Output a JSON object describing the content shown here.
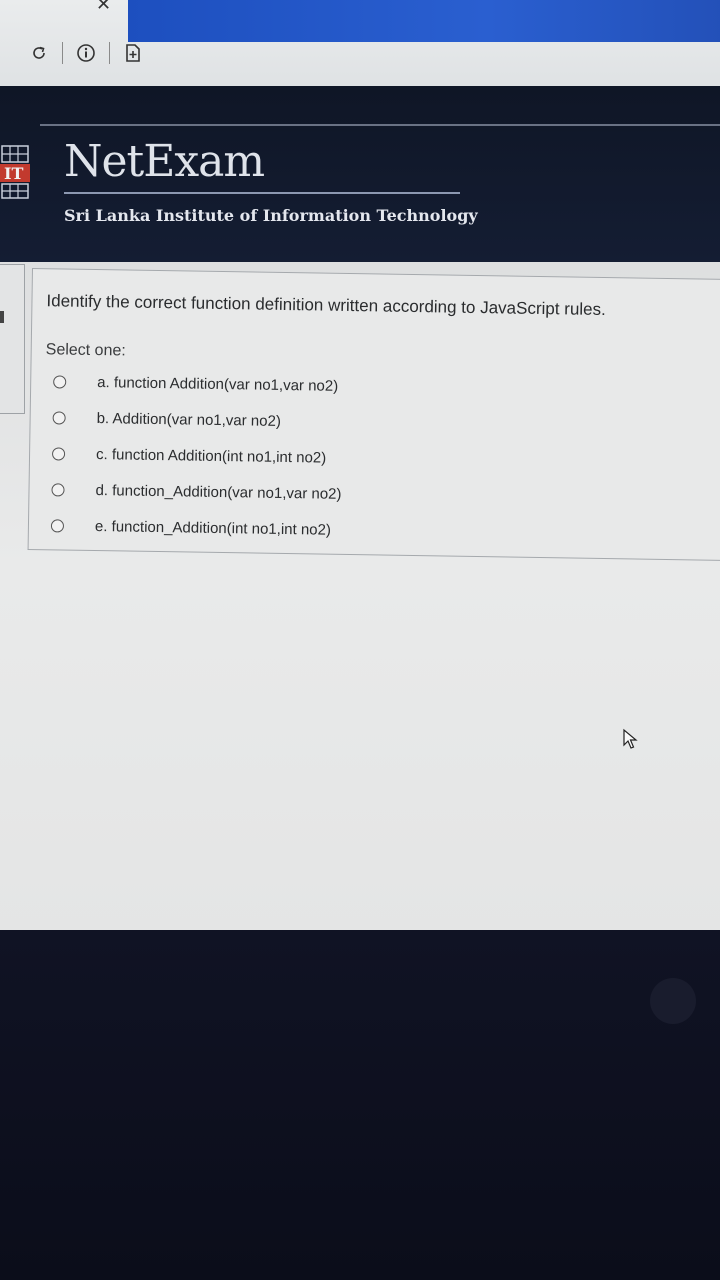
{
  "browser": {
    "icons": [
      "close-icon",
      "refresh-icon",
      "info-icon",
      "bookmark-add-icon"
    ]
  },
  "header": {
    "brand": "NetExam",
    "subtitle": "Sri Lanka Institute of Information Technology",
    "accent_color": "#e1662f"
  },
  "question": {
    "text": "Identify the correct function definition written according to JavaScript rules.",
    "prompt": "Select one:",
    "options": [
      {
        "label": "a. function Addition(var no1,var no2)",
        "selected": false
      },
      {
        "label": "b. Addition(var no1,var no2)",
        "selected": false
      },
      {
        "label": "c. function Addition(int no1,int no2)",
        "selected": false
      },
      {
        "label": "d. function_Addition(var no1,var no2)",
        "selected": false
      },
      {
        "label": "e. function_Addition(int no1,int no2)",
        "selected": false
      }
    ]
  }
}
